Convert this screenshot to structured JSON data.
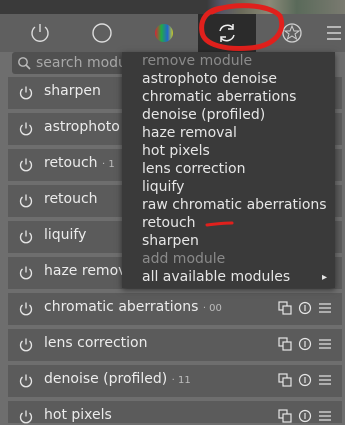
{
  "search": {
    "placeholder": "search modules"
  },
  "tabs": [
    {
      "icon": "power-icon"
    },
    {
      "icon": "circle-icon"
    },
    {
      "icon": "color-icon"
    },
    {
      "icon": "reload-icon",
      "active": true
    },
    {
      "icon": "star-shape-icon"
    },
    {
      "icon": "hamburger-icon"
    }
  ],
  "modules": [
    {
      "name": "sharpen",
      "instance": ""
    },
    {
      "name": "astrophoto denoise",
      "instance": ""
    },
    {
      "name": "retouch",
      "instance": "· 1"
    },
    {
      "name": "retouch",
      "instance": ""
    },
    {
      "name": "liquify",
      "instance": ""
    },
    {
      "name": "haze removal",
      "instance": ""
    },
    {
      "name": "chromatic aberrations",
      "instance": "· 00"
    },
    {
      "name": "lens correction",
      "instance": ""
    },
    {
      "name": "denoise (profiled)",
      "instance": "· 11"
    },
    {
      "name": "hot pixels",
      "instance": ""
    }
  ],
  "popup": {
    "remove_header": "remove module",
    "remove_items": [
      "astrophoto denoise",
      "chromatic aberrations",
      "denoise (profiled)",
      "haze removal",
      "hot pixels",
      "lens correction",
      "liquify",
      "raw chromatic aberrations",
      "retouch",
      "sharpen"
    ],
    "add_header": "add module",
    "add_items": [
      "all available modules"
    ]
  },
  "colors": {
    "accent_annotation": "#e0201c",
    "popup_bg": "#3a3a3a",
    "row_bg": "#5b5b5b"
  }
}
